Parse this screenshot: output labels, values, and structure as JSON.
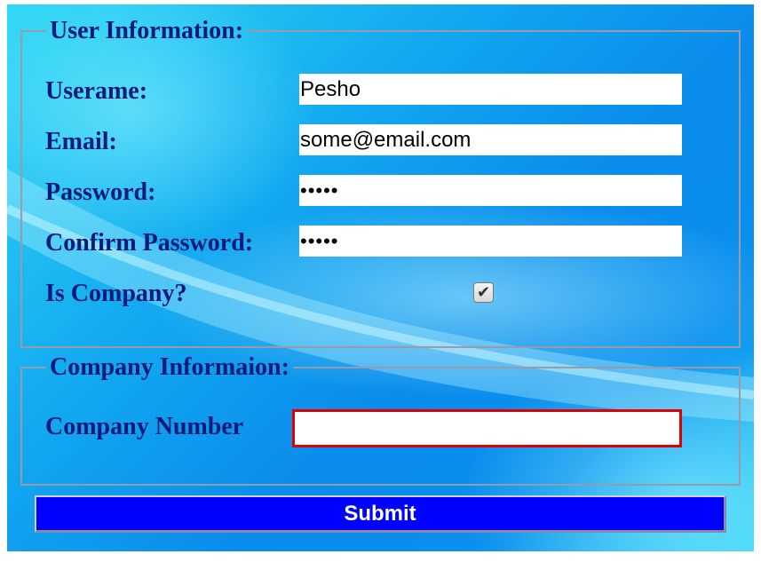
{
  "user_info": {
    "legend": "User Information:",
    "username_label": "Userame:",
    "username_value": "Pesho",
    "email_label": "Email:",
    "email_value": "some@email.com",
    "password_label": "Password:",
    "password_value": "•••••",
    "confirm_password_label": "Confirm Password:",
    "confirm_password_value": "•••••",
    "is_company_label": "Is Company?",
    "is_company_checked": "✔"
  },
  "company_info": {
    "legend": "Company Informaion:",
    "company_number_label": "Company Number",
    "company_number_value": ""
  },
  "submit_label": "Submit",
  "colors": {
    "label_text": "#0a1a7a",
    "submit_bg": "#0000ff",
    "error_border": "#e10000"
  }
}
